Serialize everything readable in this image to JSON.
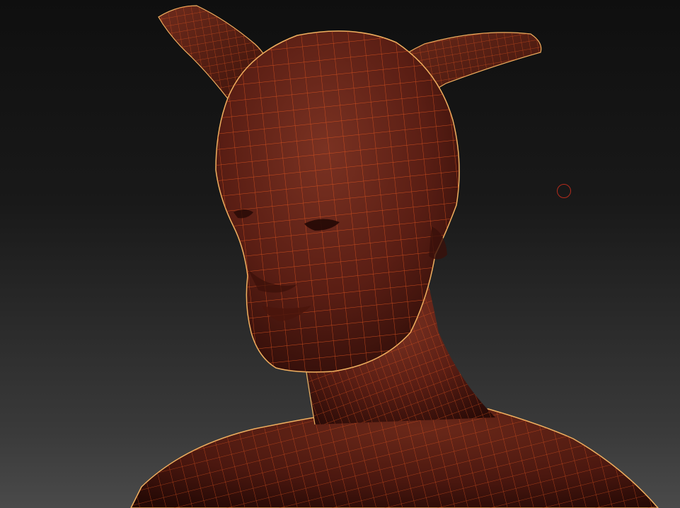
{
  "viewport": {
    "background_top": "#0f0f0f",
    "background_bottom": "#4a4a4a"
  },
  "model": {
    "material_color": "#5a1e14",
    "material_highlight": "#7a3222",
    "material_shadow": "#2a0b07",
    "wireframe_color": "#e0531e",
    "rim_light_color": "#f0b060",
    "wireframe_visible": true
  },
  "brush_cursor": {
    "icon": "circle-brush-icon",
    "color": "#b32b1c"
  }
}
